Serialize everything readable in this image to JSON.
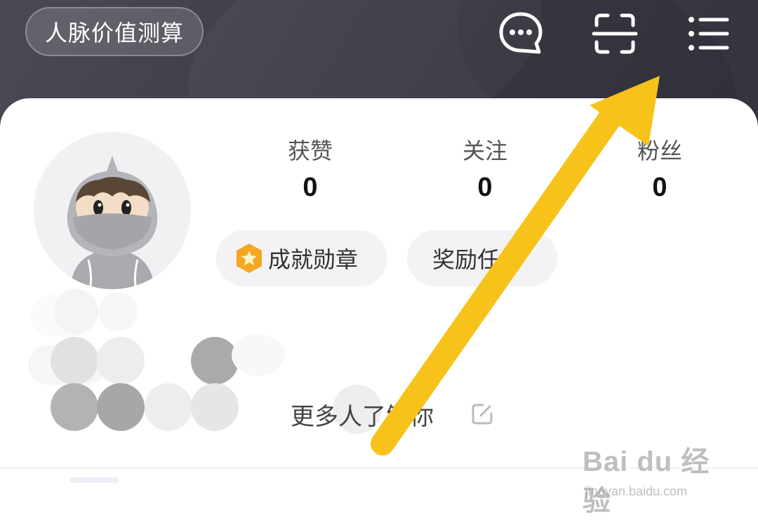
{
  "header": {
    "pill_label": "人脉价值测算",
    "icons": [
      "chat-bubble-icon",
      "scan-icon",
      "menu-icon"
    ],
    "bg_color": "#3f3f4a"
  },
  "profile": {
    "avatar_icon": "ninja-avatar-icon",
    "stats": [
      {
        "label": "获赞",
        "value": "0"
      },
      {
        "label": "关注",
        "value": "0"
      },
      {
        "label": "粉丝",
        "value": "0"
      }
    ],
    "chips": [
      {
        "label": "成就勋章",
        "icon": "badge-star-icon"
      },
      {
        "label": "奖励任务",
        "icon": ""
      }
    ],
    "bio_placeholder": "更多人了解你",
    "edit_icon": "edit-icon"
  },
  "annotation": {
    "arrow_color": "#f7c21a",
    "arrow_target": "menu-icon"
  },
  "watermark": {
    "main": "Bai du 经验",
    "sub": "jingyan.baidu.com"
  }
}
